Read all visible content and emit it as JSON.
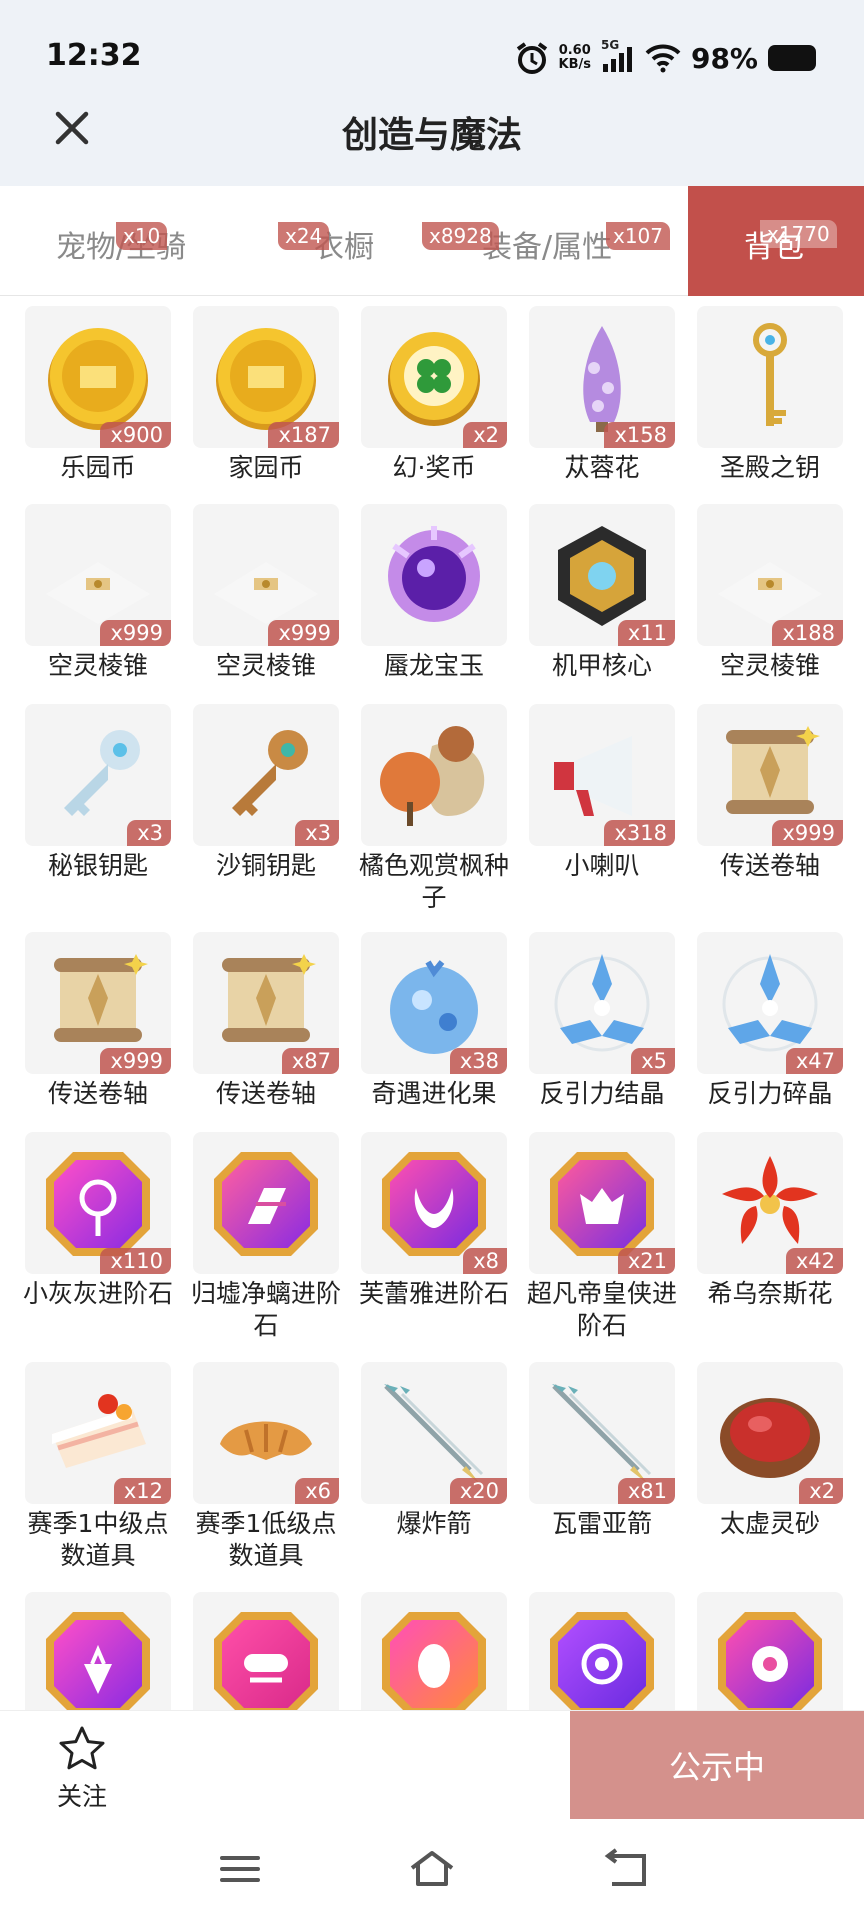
{
  "status_bar": {
    "time": "12:32",
    "net_speed_value": "0.60",
    "net_speed_unit": "KB/s",
    "network": "5G",
    "battery": "98%"
  },
  "header": {
    "title": "创造与魔法"
  },
  "tabs": [
    {
      "label": "宠物/坐骑",
      "badge": "x10",
      "active": false
    },
    {
      "label": "衣橱",
      "badge": "x24",
      "active": false
    },
    {
      "label": "装备/属性",
      "badge": "x8928",
      "active": false
    },
    {
      "label": "",
      "badge": "x107",
      "active": false
    },
    {
      "label": "背包",
      "badge": "x1770",
      "active": true
    }
  ],
  "items": [
    {
      "name": "乐园币",
      "count": "x900",
      "icon": "gold-coin-icon"
    },
    {
      "name": "家园币",
      "count": "x187",
      "icon": "gold-coin-icon"
    },
    {
      "name": "幻·奖币",
      "count": "x2",
      "icon": "clover-coin-icon"
    },
    {
      "name": "苁蓉花",
      "count": "x158",
      "icon": "purple-flower-icon"
    },
    {
      "name": "圣殿之钥",
      "count": "",
      "icon": "golden-key-icon"
    },
    {
      "name": "空灵棱锥",
      "count": "x999",
      "icon": "white-pyramid-icon"
    },
    {
      "name": "空灵棱锥",
      "count": "x999",
      "icon": "white-pyramid-icon"
    },
    {
      "name": "蜃龙宝玉",
      "count": "",
      "icon": "purple-orb-icon"
    },
    {
      "name": "机甲核心",
      "count": "x11",
      "icon": "mech-core-icon"
    },
    {
      "name": "空灵棱锥",
      "count": "x188",
      "icon": "white-pyramid-icon"
    },
    {
      "name": "秘银钥匙",
      "count": "x3",
      "icon": "silver-key-icon"
    },
    {
      "name": "沙铜钥匙",
      "count": "x3",
      "icon": "bronze-key-icon"
    },
    {
      "name": "橘色观赏枫种子",
      "count": "",
      "icon": "maple-seed-bag-icon"
    },
    {
      "name": "小喇叭",
      "count": "x318",
      "icon": "megaphone-icon"
    },
    {
      "name": "传送卷轴",
      "count": "x999",
      "icon": "scroll-icon"
    },
    {
      "name": "传送卷轴",
      "count": "x999",
      "icon": "scroll-icon"
    },
    {
      "name": "传送卷轴",
      "count": "x87",
      "icon": "scroll-icon"
    },
    {
      "name": "奇遇进化果",
      "count": "x38",
      "icon": "blue-fruit-icon"
    },
    {
      "name": "反引力结晶",
      "count": "x5",
      "icon": "blue-crystal-icon"
    },
    {
      "name": "反引力碎晶",
      "count": "x47",
      "icon": "blue-crystal-icon"
    },
    {
      "name": "小灰灰进阶石",
      "count": "x110",
      "icon": "lollipop-gem-icon"
    },
    {
      "name": "归墟净螭进阶石",
      "count": "",
      "icon": "claw-gem-icon"
    },
    {
      "name": "芙蕾雅进阶石",
      "count": "x8",
      "icon": "horns-gem-icon"
    },
    {
      "name": "超凡帝皇侠进阶石",
      "count": "x21",
      "icon": "crown-gem-icon"
    },
    {
      "name": "希乌奈斯花",
      "count": "x42",
      "icon": "red-flower-icon"
    },
    {
      "name": "赛季1中级点数道具",
      "count": "x12",
      "icon": "cake-icon"
    },
    {
      "name": "赛季1低级点数道具",
      "count": "x6",
      "icon": "croissant-icon"
    },
    {
      "name": "爆炸箭",
      "count": "x20",
      "icon": "arrow-icon"
    },
    {
      "name": "瓦雷亚箭",
      "count": "x81",
      "icon": "arrow-icon"
    },
    {
      "name": "太虚灵砂",
      "count": "x2",
      "icon": "red-sand-bowl-icon"
    },
    {
      "name": "",
      "count": "",
      "icon": "carrot-gem-icon"
    },
    {
      "name": "",
      "count": "",
      "icon": "goggles-gem-icon"
    },
    {
      "name": "",
      "count": "",
      "icon": "egg-gem-icon"
    },
    {
      "name": "",
      "count": "",
      "icon": "swirl-gem-icon"
    },
    {
      "name": "",
      "count": "",
      "icon": "flower-gem-icon"
    }
  ],
  "bottom_bar": {
    "follow_label": "关注",
    "public_label": "公示中"
  },
  "colors": {
    "accent": "#c2504b",
    "badge": "#c05650",
    "public_button": "#d4918c"
  }
}
